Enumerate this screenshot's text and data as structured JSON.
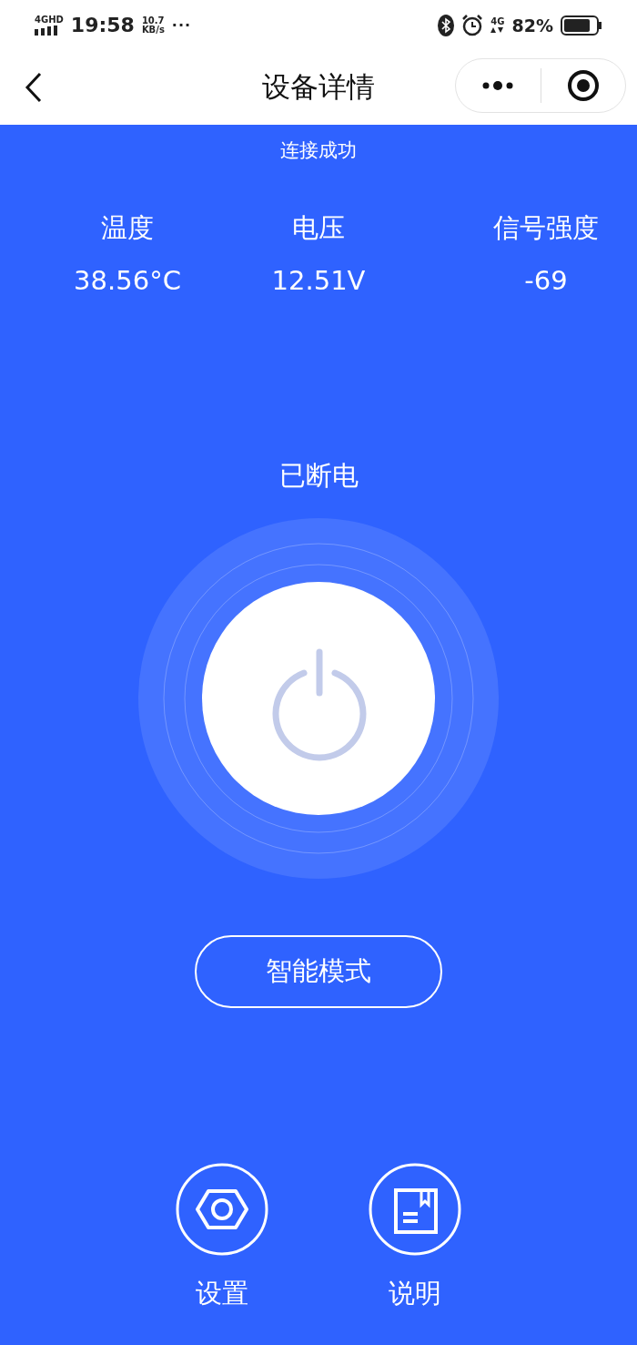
{
  "status_bar": {
    "network": "4GHD",
    "time": "19:58",
    "speed_value": "10.7",
    "speed_unit": "KB/s",
    "more": "···",
    "data_network": "4G",
    "battery": "82%"
  },
  "nav": {
    "title": "设备详情"
  },
  "connection_status": "连接成功",
  "stats": [
    {
      "label": "温度",
      "value": "38.56°C"
    },
    {
      "label": "电压",
      "value": "12.51V"
    },
    {
      "label": "信号强度",
      "value": "-69"
    }
  ],
  "power": {
    "status": "已断电",
    "on": false
  },
  "mode_button": "智能模式",
  "actions": [
    {
      "kind": "settings",
      "label": "设置"
    },
    {
      "kind": "manual",
      "label": "说明"
    }
  ]
}
